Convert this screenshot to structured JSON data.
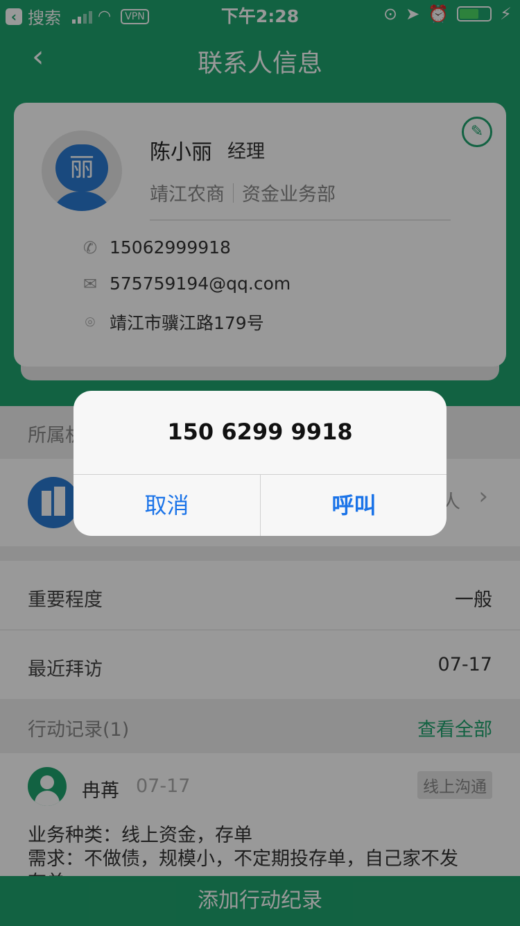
{
  "status_bar": {
    "back_label": "搜索",
    "vpn": "VPN",
    "time": "下午2:28",
    "battery_level": 0.64
  },
  "nav": {
    "back_icon": "chevron-left-icon",
    "title": "联系人信息"
  },
  "contact": {
    "avatar_char": "丽",
    "name": "陈小丽",
    "title": "经理",
    "company": "靖江农商",
    "department": "资金业务部",
    "phone": "15062999918",
    "email": "575759194@qq.com",
    "address": "靖江市骥江路179号"
  },
  "sections": {
    "org_label": "所属机构",
    "org_tail": "人",
    "importance_label": "重要程度",
    "importance_value": "一般",
    "last_visit_label": "最近拜访",
    "last_visit_value": "07-17",
    "records_label": "行动记录(1)",
    "view_all": "查看全部"
  },
  "record": {
    "user": "冉苒",
    "date": "07-17",
    "tag": "线上沟通",
    "line1": "业务种类：线上资金，存单",
    "line2": "需求：不做债，规模小，不定期投存单，自己家不发",
    "line3": "存单"
  },
  "bottom_button": "添加行动纪录",
  "alert": {
    "message": "150 6299 9918",
    "cancel": "取消",
    "call": "呼叫"
  },
  "colors": {
    "brand_green": "#1fa46e",
    "avatar_blue": "#2b7bd3",
    "ios_blue": "#1a73e8"
  }
}
